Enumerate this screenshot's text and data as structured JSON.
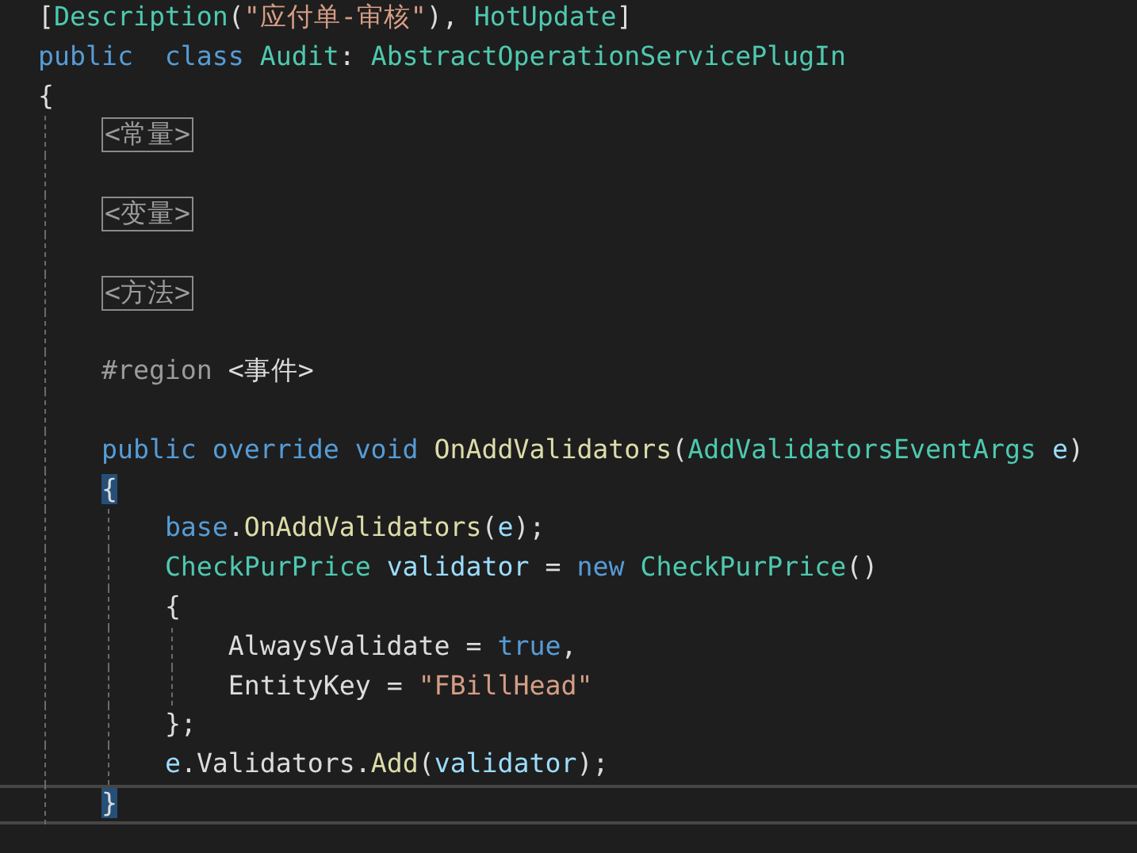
{
  "editor": {
    "lines": [
      {
        "current": false,
        "brace_match": false,
        "tokens": [
          {
            "kind": "punct",
            "text": "["
          },
          {
            "kind": "type",
            "text": "Description"
          },
          {
            "kind": "punct",
            "text": "("
          },
          {
            "kind": "string",
            "text": "\"应付单-审核\""
          },
          {
            "kind": "punct",
            "text": "), "
          },
          {
            "kind": "type",
            "text": "HotUpdate"
          },
          {
            "kind": "punct",
            "text": "]"
          }
        ]
      },
      {
        "current": false,
        "brace_match": false,
        "tokens": [
          {
            "kind": "keyword",
            "text": "public  class"
          },
          {
            "kind": "type",
            "text": " Audit"
          },
          {
            "kind": "punct",
            "text": ":"
          },
          {
            "kind": "type",
            "text": " AbstractOperationServicePlugIn"
          }
        ]
      },
      {
        "current": false,
        "brace_match": false,
        "tokens": [
          {
            "kind": "punct",
            "text": "{"
          }
        ]
      },
      {
        "current": false,
        "brace_match": false,
        "tokens": [
          {
            "kind": "collapsed",
            "text": "    <常量>"
          }
        ]
      },
      {
        "current": false
      },
      {
        "current": false,
        "brace_match": false,
        "tokens": [
          {
            "kind": "collapsed",
            "text": "    <变量>"
          }
        ]
      },
      {
        "current": false
      },
      {
        "current": false,
        "brace_match": false,
        "tokens": [
          {
            "kind": "collapsed",
            "text": "    <方法>"
          }
        ]
      },
      {
        "current": false
      },
      {
        "current": false,
        "brace_match": false,
        "tokens": [
          {
            "kind": "preprocessor",
            "text": "    #region"
          },
          {
            "kind": "plain",
            "text": " <事件>"
          }
        ]
      },
      {
        "current": false
      },
      {
        "current": false,
        "brace_match": false,
        "tokens": [
          {
            "kind": "keyword",
            "text": "    public override void"
          },
          {
            "kind": "method",
            "text": " OnAddValidators"
          },
          {
            "kind": "punct",
            "text": "("
          },
          {
            "kind": "type",
            "text": "AddValidatorsEventArgs"
          },
          {
            "kind": "variable",
            "text": " e"
          },
          {
            "kind": "punct",
            "text": ")"
          }
        ]
      },
      {
        "current": false,
        "brace_match": true,
        "tokens": [
          {
            "kind": "punct",
            "text": "    {"
          }
        ]
      },
      {
        "current": false,
        "brace_match": false,
        "tokens": [
          {
            "kind": "keyword",
            "text": "        base"
          },
          {
            "kind": "punct",
            "text": "."
          },
          {
            "kind": "method",
            "text": "OnAddValidators"
          },
          {
            "kind": "punct",
            "text": "("
          },
          {
            "kind": "variable",
            "text": "e"
          },
          {
            "kind": "punct",
            "text": ");"
          }
        ]
      },
      {
        "current": false,
        "brace_match": false,
        "tokens": [
          {
            "kind": "type",
            "text": "        CheckPurPrice"
          },
          {
            "kind": "variable",
            "text": " validator"
          },
          {
            "kind": "punct",
            "text": " ="
          },
          {
            "kind": "keyword",
            "text": " new"
          },
          {
            "kind": "type",
            "text": " CheckPurPrice"
          },
          {
            "kind": "punct",
            "text": "()"
          }
        ]
      },
      {
        "current": false,
        "brace_match": false,
        "tokens": [
          {
            "kind": "punct",
            "text": "        {"
          }
        ]
      },
      {
        "current": false,
        "brace_match": false,
        "tokens": [
          {
            "kind": "plain",
            "text": "            AlwaysValidate"
          },
          {
            "kind": "punct",
            "text": " ="
          },
          {
            "kind": "keyword",
            "text": " true"
          },
          {
            "kind": "punct",
            "text": ","
          }
        ]
      },
      {
        "current": false,
        "brace_match": false,
        "tokens": [
          {
            "kind": "plain",
            "text": "            EntityKey"
          },
          {
            "kind": "punct",
            "text": " ="
          },
          {
            "kind": "string",
            "text": " \"FBillHead\""
          }
        ]
      },
      {
        "current": false,
        "brace_match": false,
        "tokens": [
          {
            "kind": "punct",
            "text": "        };"
          }
        ]
      },
      {
        "current": false,
        "brace_match": false,
        "tokens": [
          {
            "kind": "variable",
            "text": "        e"
          },
          {
            "kind": "punct",
            "text": "."
          },
          {
            "kind": "plain",
            "text": "Validators"
          },
          {
            "kind": "punct",
            "text": "."
          },
          {
            "kind": "method",
            "text": "Add"
          },
          {
            "kind": "punct",
            "text": "("
          },
          {
            "kind": "variable",
            "text": "validator"
          },
          {
            "kind": "punct",
            "text": ");"
          }
        ]
      },
      {
        "current": true,
        "brace_match": true,
        "tokens": [
          {
            "kind": "punct",
            "text": "    }"
          }
        ]
      }
    ]
  }
}
